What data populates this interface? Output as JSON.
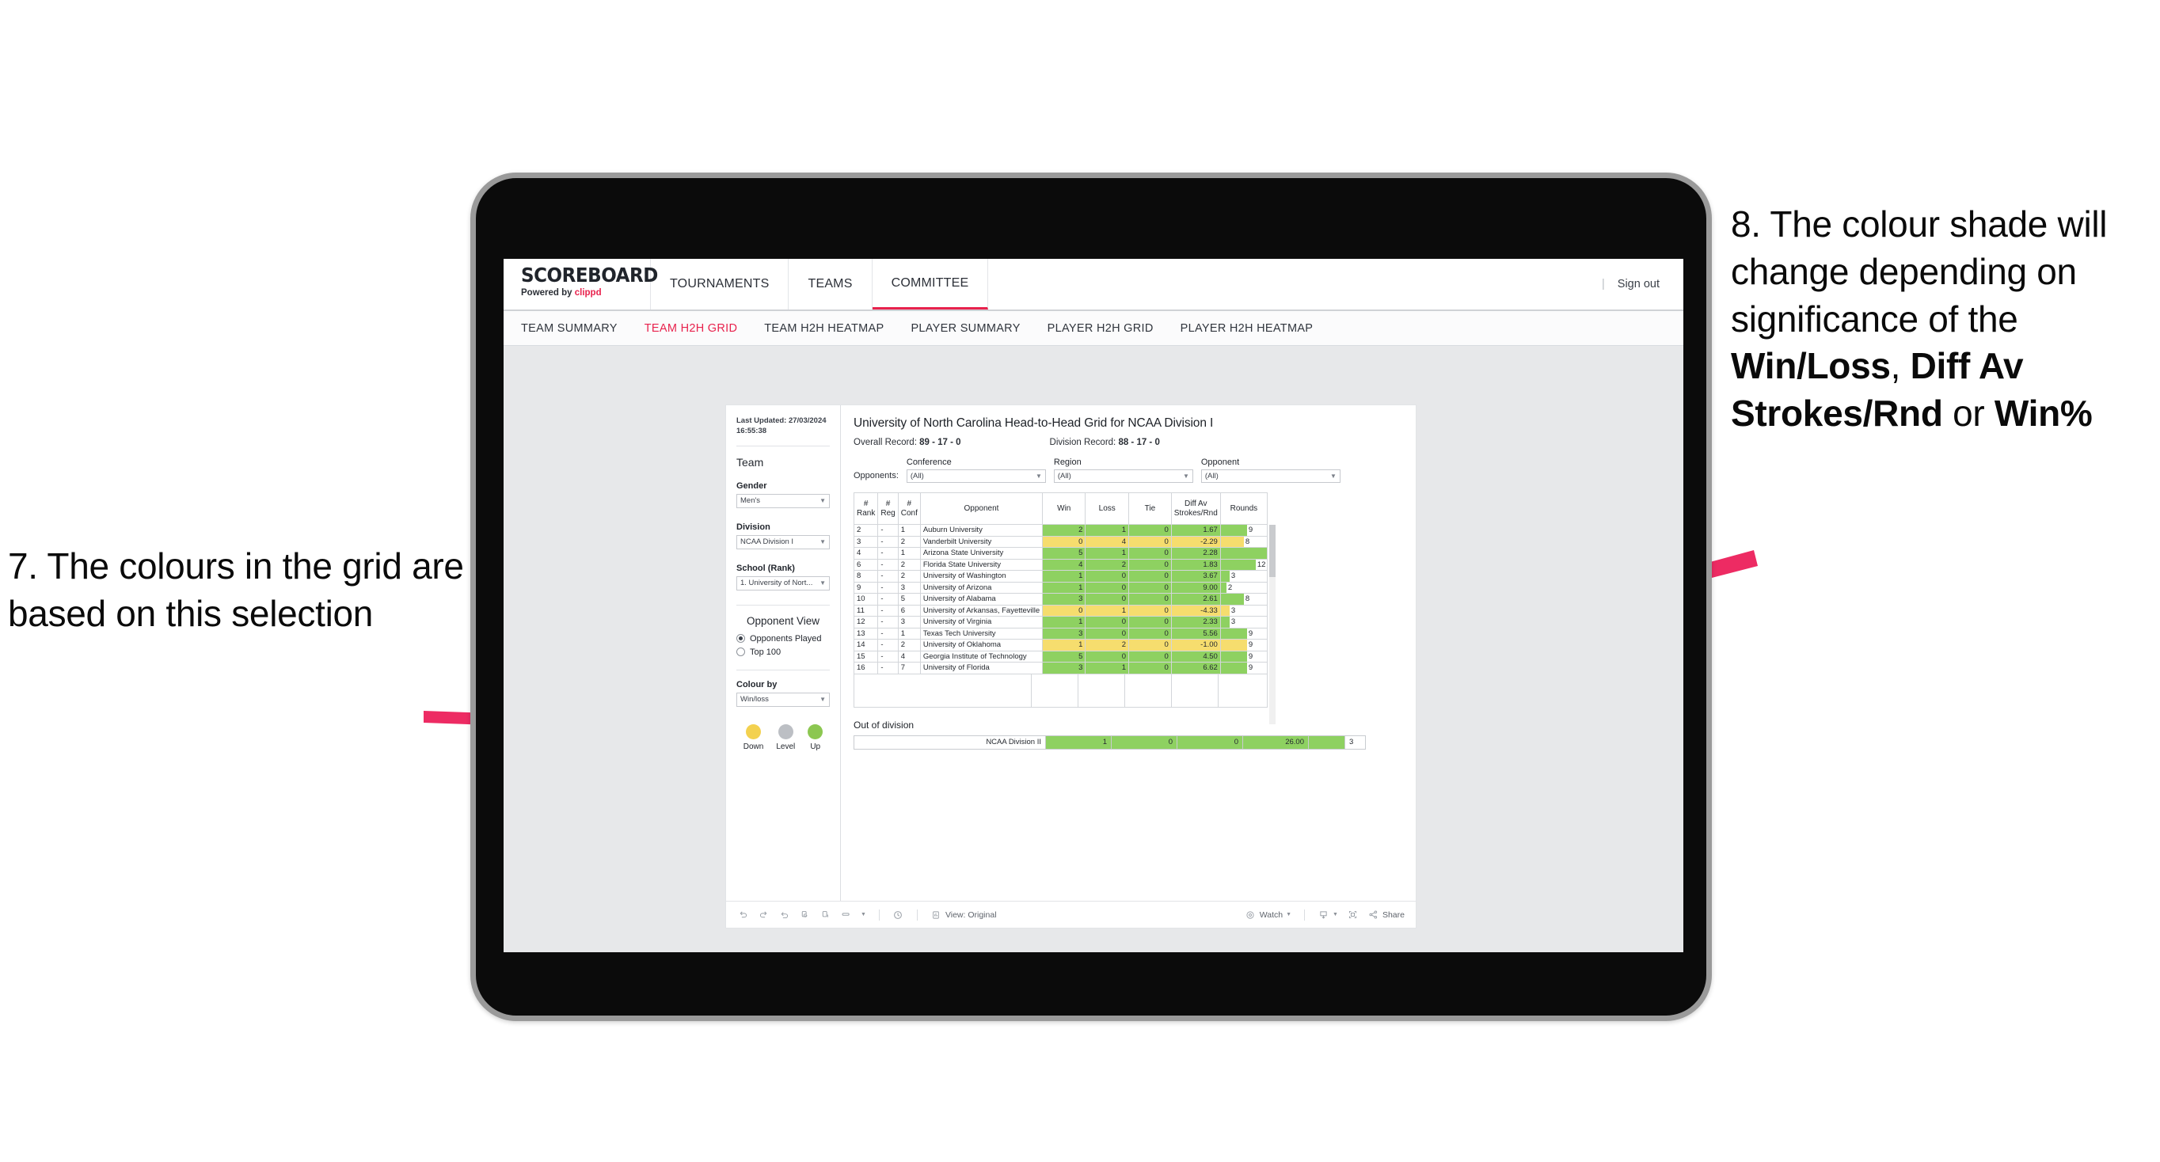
{
  "annotations": {
    "left": "7. The colours in the grid are based on this selection",
    "right_prefix": "8. The colour shade will change depending on significance of the ",
    "right_bold1": "Win/Loss",
    "right_mid1": ", ",
    "right_bold2": "Diff Av Strokes/Rnd",
    "right_mid2": " or ",
    "right_bold3": "Win%",
    "arrow_color": "#ED2B63"
  },
  "header": {
    "brand_wordmark": "SCOREBOARD",
    "powered_prefix": "Powered by ",
    "powered_brand": "clippd",
    "nav": [
      {
        "label": "TOURNAMENTS",
        "active": false
      },
      {
        "label": "TEAMS",
        "active": false
      },
      {
        "label": "COMMITTEE",
        "active": true
      }
    ],
    "signout_divider": "|",
    "signout_label": "Sign out"
  },
  "subnav": [
    {
      "label": "TEAM SUMMARY",
      "active": false
    },
    {
      "label": "TEAM H2H GRID",
      "active": true
    },
    {
      "label": "TEAM H2H HEATMAP",
      "active": false
    },
    {
      "label": "PLAYER SUMMARY",
      "active": false
    },
    {
      "label": "PLAYER H2H GRID",
      "active": false
    },
    {
      "label": "PLAYER H2H HEATMAP",
      "active": false
    }
  ],
  "filters": {
    "last_updated": "Last Updated: 27/03/2024 16:55:38",
    "team_title": "Team",
    "gender_label": "Gender",
    "gender_value": "Men's",
    "division_label": "Division",
    "division_value": "NCAA Division I",
    "school_label": "School (Rank)",
    "school_value": "1. University of Nort...",
    "opponent_view_title": "Opponent View",
    "opponent_view_options": [
      {
        "label": "Opponents Played",
        "selected": true
      },
      {
        "label": "Top 100",
        "selected": false
      }
    ],
    "colour_by_label": "Colour by",
    "colour_by_value": "Win/loss",
    "legend": [
      {
        "caption": "Down",
        "color": "#F3D14F"
      },
      {
        "caption": "Level",
        "color": "#BCBFC4"
      },
      {
        "caption": "Up",
        "color": "#8CC751"
      }
    ]
  },
  "viz": {
    "title": "University of North Carolina Head-to-Head Grid for NCAA Division I",
    "overall_record_label": "Overall Record: ",
    "overall_record_value": "89 - 17 - 0",
    "division_record_label": "Division Record: ",
    "division_record_value": "88 - 17 - 0",
    "opponents_label": "Opponents:",
    "opponent_filters": [
      {
        "label": "Conference",
        "value": "(All)"
      },
      {
        "label": "Region",
        "value": "(All)"
      },
      {
        "label": "Opponent",
        "value": "(All)"
      }
    ],
    "out_of_division_title": "Out of division"
  },
  "chart_data": {
    "type": "table",
    "title": "University of North Carolina Head-to-Head Grid for NCAA Division I",
    "columns": [
      "# Rank",
      "# Reg",
      "# Conf",
      "Opponent",
      "Win",
      "Loss",
      "Tie",
      "Diff Av Strokes/Rnd",
      "Rounds"
    ],
    "colour_by": "Win/loss",
    "colours": {
      "up": "#8ED161",
      "down": "#F6DD6E",
      "level": "#BCBFC4"
    },
    "rounds_max": 17,
    "rows": [
      {
        "rank": "2",
        "reg": "-",
        "conf": "1",
        "opponent": "Auburn University",
        "win": "2",
        "loss": "1",
        "tie": "0",
        "diff": "1.67",
        "rounds": "9",
        "shade": "g"
      },
      {
        "rank": "3",
        "reg": "-",
        "conf": "2",
        "opponent": "Vanderbilt University",
        "win": "0",
        "loss": "4",
        "tie": "0",
        "diff": "-2.29",
        "rounds": "8",
        "shade": "y"
      },
      {
        "rank": "4",
        "reg": "-",
        "conf": "1",
        "opponent": "Arizona State University",
        "win": "5",
        "loss": "1",
        "tie": "0",
        "diff": "2.28",
        "rounds": "17",
        "shade": "g"
      },
      {
        "rank": "6",
        "reg": "-",
        "conf": "2",
        "opponent": "Florida State University",
        "win": "4",
        "loss": "2",
        "tie": "0",
        "diff": "1.83",
        "rounds": "12",
        "shade": "g"
      },
      {
        "rank": "8",
        "reg": "-",
        "conf": "2",
        "opponent": "University of Washington",
        "win": "1",
        "loss": "0",
        "tie": "0",
        "diff": "3.67",
        "rounds": "3",
        "shade": "g"
      },
      {
        "rank": "9",
        "reg": "-",
        "conf": "3",
        "opponent": "University of Arizona",
        "win": "1",
        "loss": "0",
        "tie": "0",
        "diff": "9.00",
        "rounds": "2",
        "shade": "g"
      },
      {
        "rank": "10",
        "reg": "-",
        "conf": "5",
        "opponent": "University of Alabama",
        "win": "3",
        "loss": "0",
        "tie": "0",
        "diff": "2.61",
        "rounds": "8",
        "shade": "g"
      },
      {
        "rank": "11",
        "reg": "-",
        "conf": "6",
        "opponent": "University of Arkansas, Fayetteville",
        "win": "0",
        "loss": "1",
        "tie": "0",
        "diff": "-4.33",
        "rounds": "3",
        "shade": "y"
      },
      {
        "rank": "12",
        "reg": "-",
        "conf": "3",
        "opponent": "University of Virginia",
        "win": "1",
        "loss": "0",
        "tie": "0",
        "diff": "2.33",
        "rounds": "3",
        "shade": "g"
      },
      {
        "rank": "13",
        "reg": "-",
        "conf": "1",
        "opponent": "Texas Tech University",
        "win": "3",
        "loss": "0",
        "tie": "0",
        "diff": "5.56",
        "rounds": "9",
        "shade": "g"
      },
      {
        "rank": "14",
        "reg": "-",
        "conf": "2",
        "opponent": "University of Oklahoma",
        "win": "1",
        "loss": "2",
        "tie": "0",
        "diff": "-1.00",
        "rounds": "9",
        "shade": "y"
      },
      {
        "rank": "15",
        "reg": "-",
        "conf": "4",
        "opponent": "Georgia Institute of Technology",
        "win": "5",
        "loss": "0",
        "tie": "0",
        "diff": "4.50",
        "rounds": "9",
        "shade": "g"
      },
      {
        "rank": "16",
        "reg": "-",
        "conf": "7",
        "opponent": "University of Florida",
        "win": "3",
        "loss": "1",
        "tie": "0",
        "diff": "6.62",
        "rounds": "9",
        "shade": "g"
      }
    ],
    "out_of_division": [
      {
        "name": "NCAA Division II",
        "win": "1",
        "loss": "0",
        "tie": "0",
        "diff": "26.00",
        "rounds": "3",
        "shade": "g"
      }
    ]
  },
  "toolbar": {
    "view_label": "View: Original",
    "watch_label": "Watch",
    "share_label": "Share"
  }
}
